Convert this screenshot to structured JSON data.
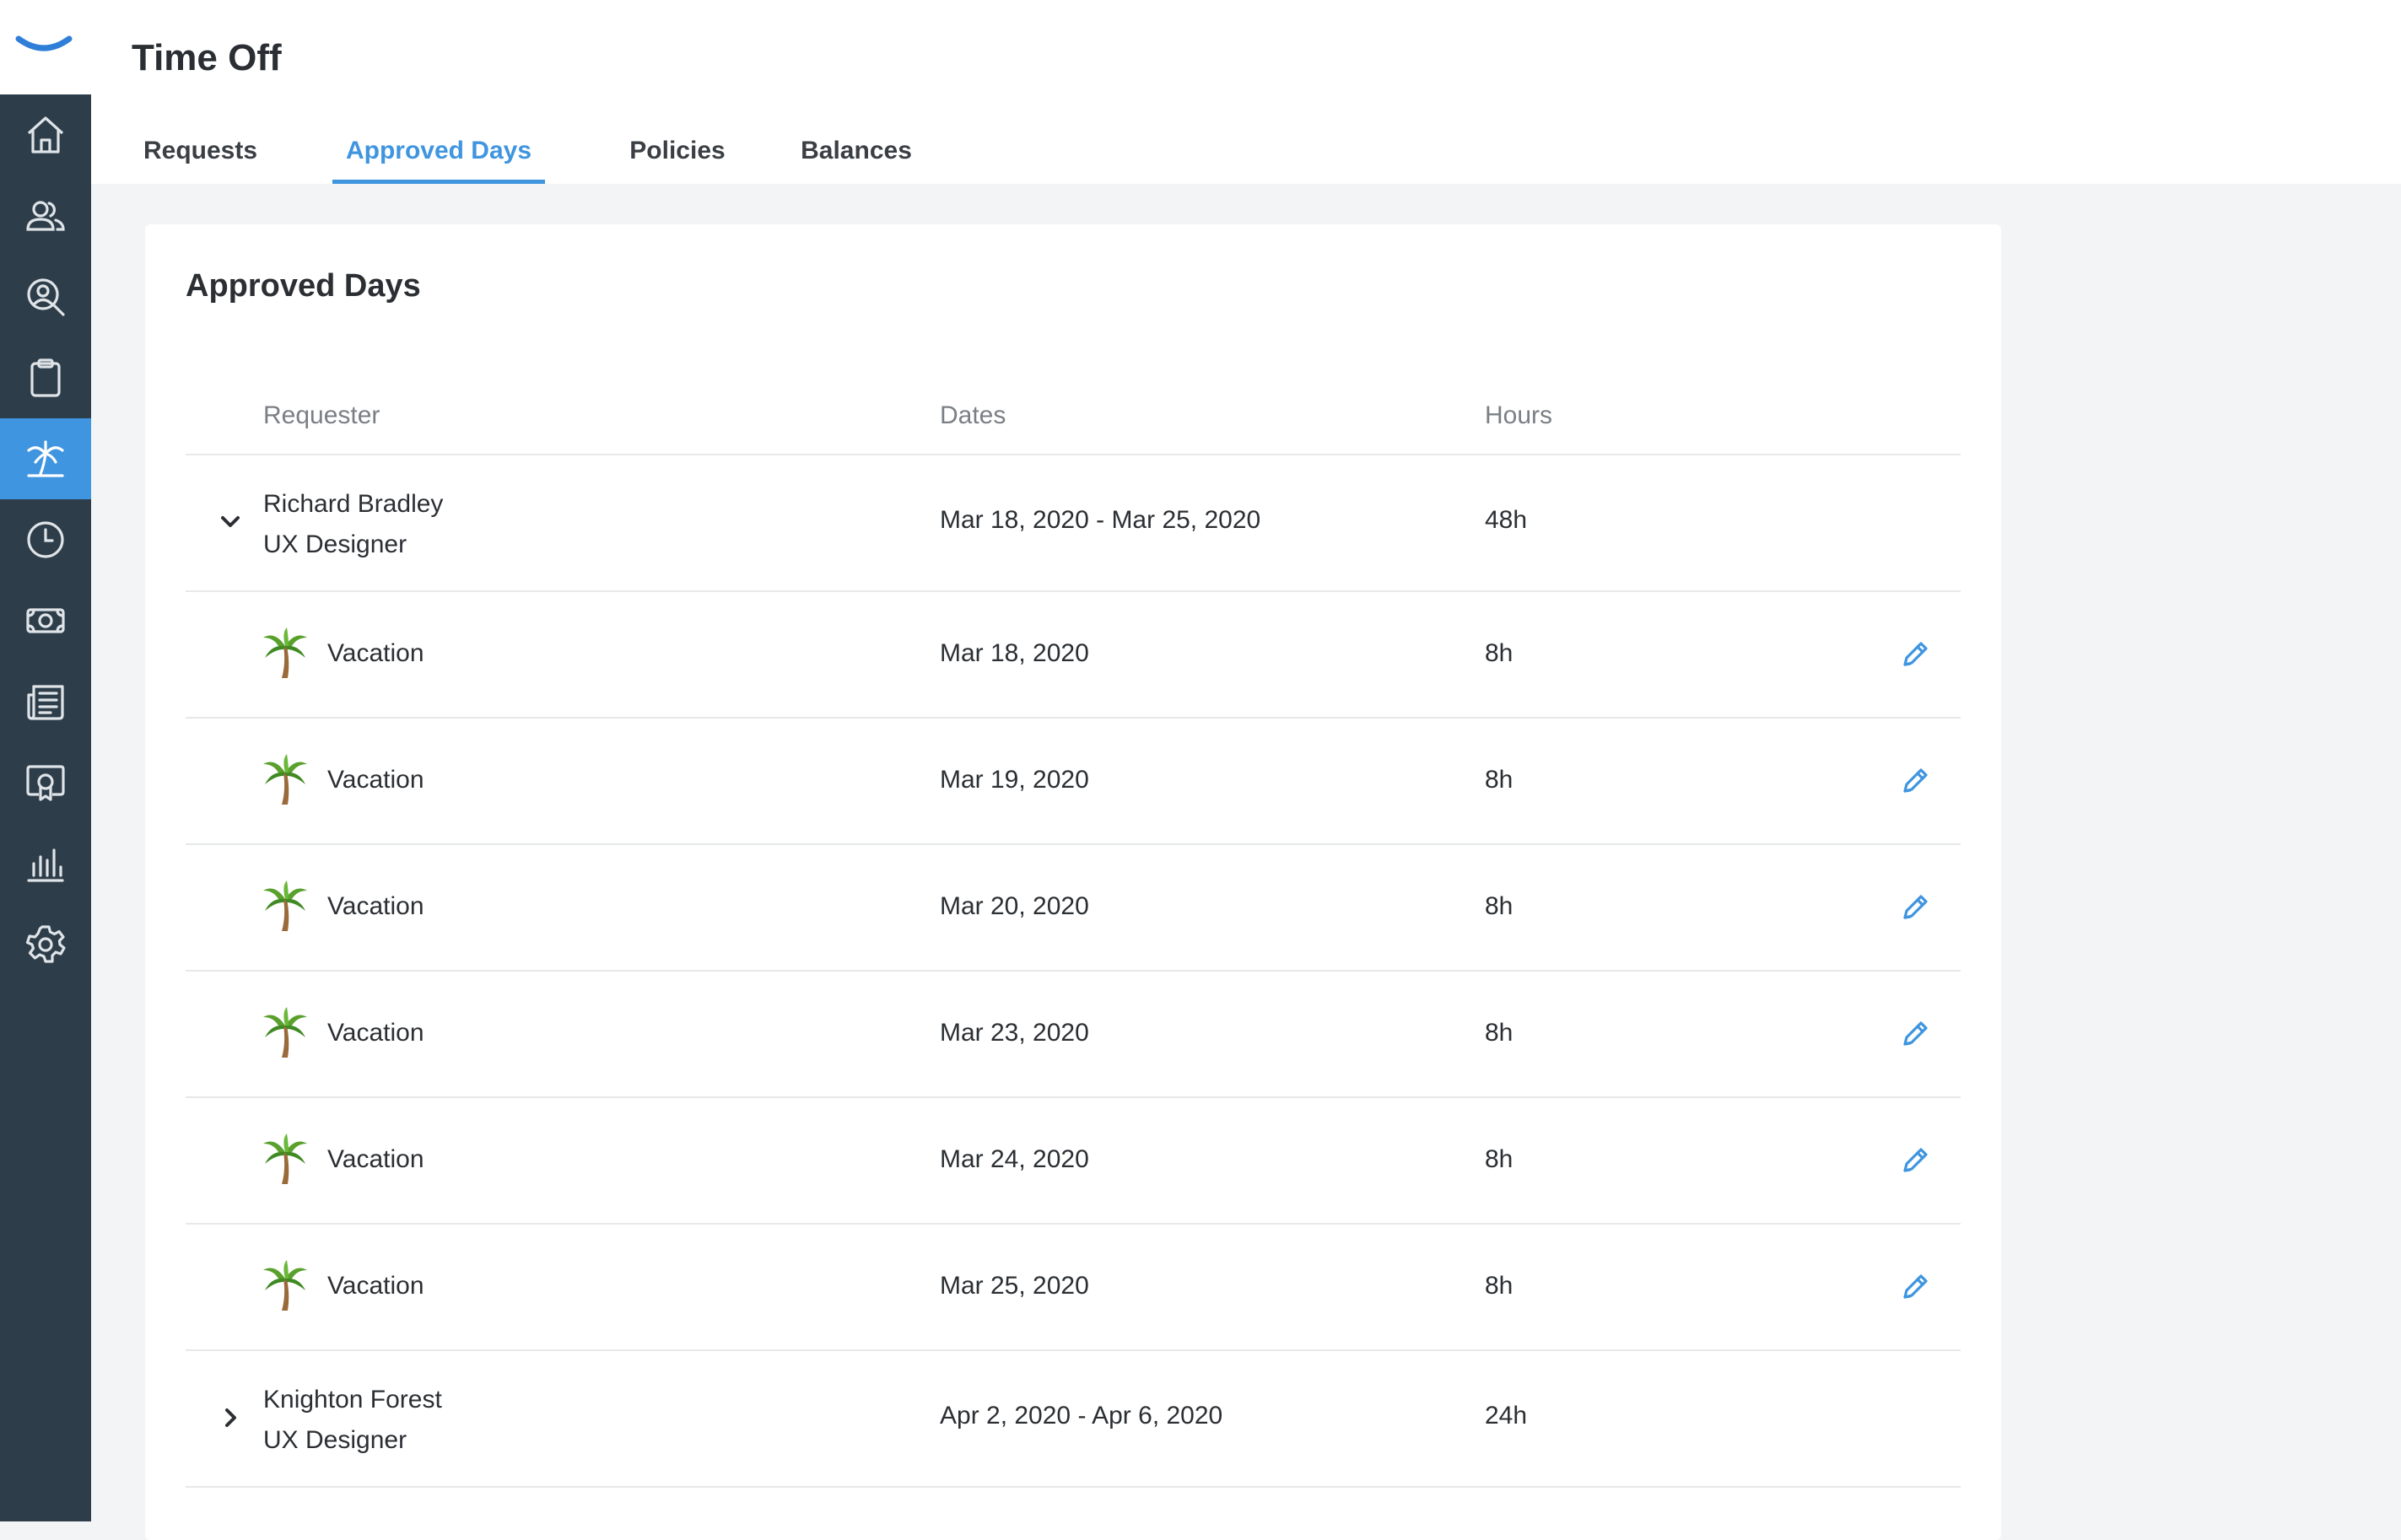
{
  "header": {
    "title": "Time Off"
  },
  "tabs": [
    {
      "label": "Requests"
    },
    {
      "label": "Approved Days"
    },
    {
      "label": "Policies"
    },
    {
      "label": "Balances"
    }
  ],
  "active_tab": "Approved Days",
  "card": {
    "title": "Approved Days",
    "columns": {
      "requester": "Requester",
      "dates": "Dates",
      "hours": "Hours"
    },
    "groups": [
      {
        "name": "Richard Bradley",
        "role": "UX Designer",
        "dates": "Mar 18, 2020 - Mar 25, 2020",
        "hours": "48h",
        "expanded": true,
        "days": [
          {
            "type": "Vacation",
            "date": "Mar 18, 2020",
            "hours": "8h"
          },
          {
            "type": "Vacation",
            "date": "Mar 19, 2020",
            "hours": "8h"
          },
          {
            "type": "Vacation",
            "date": "Mar 20, 2020",
            "hours": "8h"
          },
          {
            "type": "Vacation",
            "date": "Mar 23, 2020",
            "hours": "8h"
          },
          {
            "type": "Vacation",
            "date": "Mar 24, 2020",
            "hours": "8h"
          },
          {
            "type": "Vacation",
            "date": "Mar 25, 2020",
            "hours": "8h"
          }
        ]
      },
      {
        "name": "Knighton Forest",
        "role": "UX Designer",
        "dates": "Apr 2, 2020 - Apr 6, 2020",
        "hours": "24h",
        "expanded": false
      }
    ]
  },
  "sidebar": {
    "items": [
      {
        "icon": "home-icon"
      },
      {
        "icon": "people-icon"
      },
      {
        "icon": "user-search-icon"
      },
      {
        "icon": "clipboard-icon"
      },
      {
        "icon": "palm-tree-icon",
        "active": true
      },
      {
        "icon": "clock-icon"
      },
      {
        "icon": "money-icon"
      },
      {
        "icon": "news-icon"
      },
      {
        "icon": "certificate-icon"
      },
      {
        "icon": "bar-chart-icon"
      },
      {
        "icon": "gear-icon"
      }
    ]
  },
  "colors": {
    "sidebar": "#2e3d4a",
    "accent": "#3f95df",
    "border": "#e6e8ea"
  }
}
